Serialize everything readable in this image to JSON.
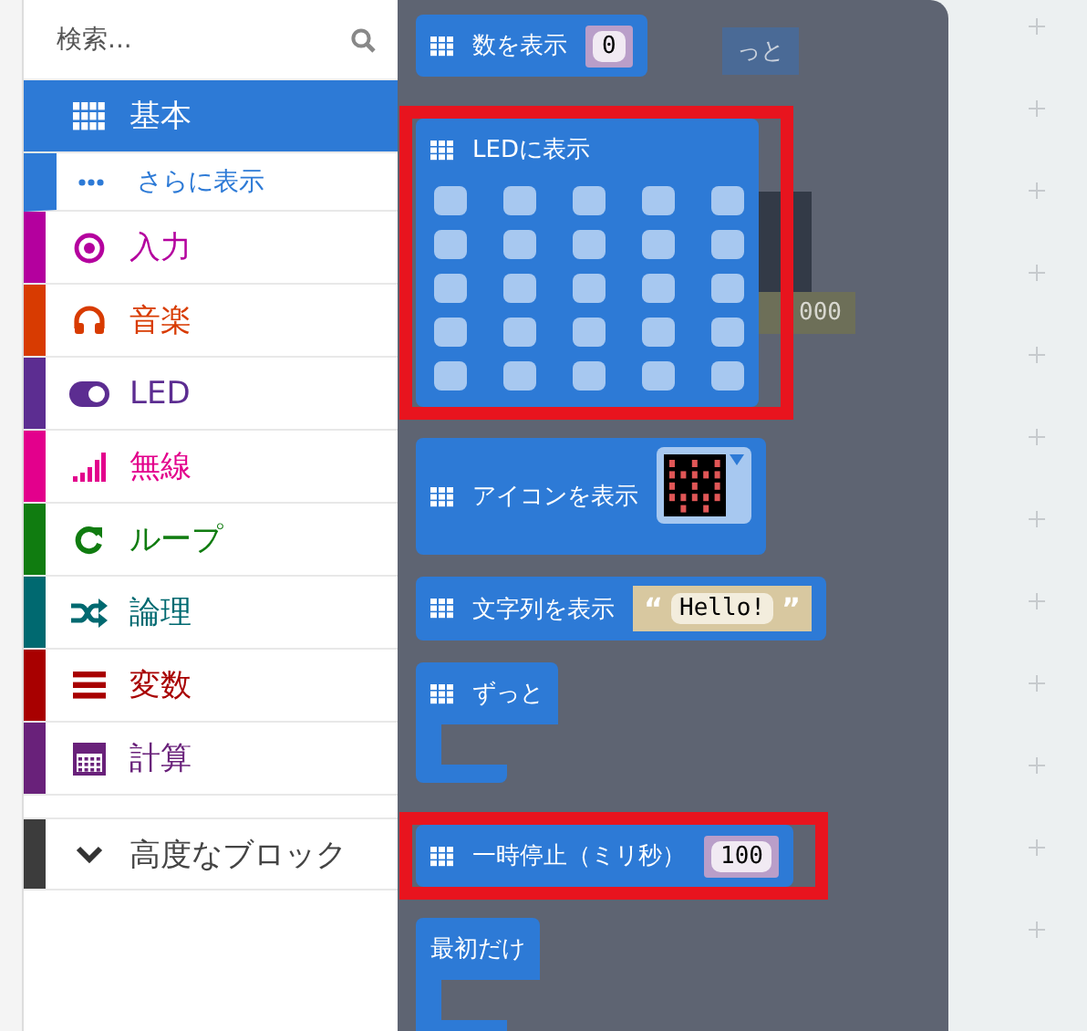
{
  "search": {
    "placeholder": "検索..."
  },
  "categories": [
    {
      "label": "基本",
      "color": "#2d7ad6",
      "selected": true,
      "children": [
        {
          "label": "さらに表示"
        }
      ]
    },
    {
      "label": "入力",
      "color": "#b4009e",
      "selected": false
    },
    {
      "label": "音楽",
      "color": "#d83b01",
      "selected": false
    },
    {
      "label": "LED",
      "color": "#5c2d91",
      "selected": false
    },
    {
      "label": "無線",
      "color": "#e3008c",
      "selected": false
    },
    {
      "label": "ループ",
      "color": "#107c10",
      "selected": false
    },
    {
      "label": "論理",
      "color": "#006970",
      "selected": false
    },
    {
      "label": "変数",
      "color": "#a80000",
      "selected": false
    },
    {
      "label": "計算",
      "color": "#69217a",
      "selected": false
    }
  ],
  "advanced": {
    "label": "高度なブロック",
    "expanded": false
  },
  "ghosts": [
    "っと",
    "000"
  ],
  "blocks": [
    {
      "kind": "statement",
      "label": "数を表示",
      "show_icon": true,
      "highlighted": false,
      "input": {
        "kind": "number",
        "value": "0"
      }
    },
    {
      "kind": "leds",
      "label": "LEDに表示",
      "show_icon": true,
      "highlighted": true,
      "leds": [
        [
          false,
          false,
          false,
          false,
          false
        ],
        [
          false,
          false,
          false,
          false,
          false
        ],
        [
          false,
          false,
          false,
          false,
          false
        ],
        [
          false,
          false,
          false,
          false,
          false
        ],
        [
          false,
          false,
          false,
          false,
          false
        ]
      ]
    },
    {
      "kind": "statement",
      "label": "アイコンを表示",
      "show_icon": true,
      "highlighted": false,
      "input": {
        "kind": "icon"
      }
    },
    {
      "kind": "statement",
      "label": "文字列を表示",
      "show_icon": true,
      "highlighted": false,
      "input": {
        "kind": "string",
        "value": "Hello!",
        "open_quote": "“",
        "close_quote": "”"
      }
    },
    {
      "kind": "loop",
      "label": "ずっと",
      "show_icon": true,
      "highlighted": false
    },
    {
      "kind": "statement",
      "label": "一時停止（ミリ秒）",
      "show_icon": true,
      "highlighted": true,
      "input": {
        "kind": "number",
        "value": "100"
      }
    },
    {
      "kind": "loop",
      "label": "最初だけ",
      "show_icon": false,
      "highlighted": false
    }
  ]
}
